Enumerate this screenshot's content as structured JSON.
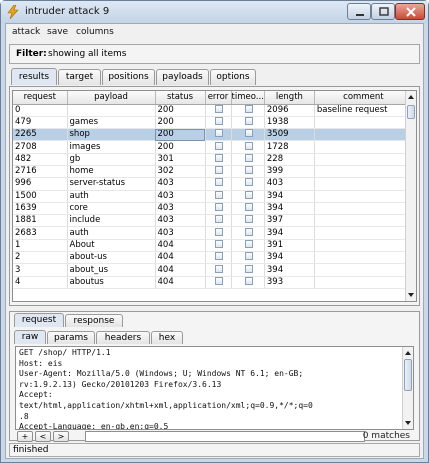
{
  "window": {
    "title": "intruder attack 9"
  },
  "menu": [
    "attack",
    "save",
    "columns"
  ],
  "filter": {
    "label": "Filter:",
    "text": "showing all items"
  },
  "tabs": [
    "results",
    "target",
    "positions",
    "payloads",
    "options"
  ],
  "table": {
    "columns": [
      "request",
      "payload",
      "status",
      "error",
      "timeo...",
      "length",
      "comment"
    ],
    "rows": [
      {
        "request": "0",
        "payload": "",
        "status": "200",
        "length": "2096",
        "comment": "baseline request"
      },
      {
        "request": "479",
        "payload": "games",
        "status": "200",
        "length": "1938",
        "comment": ""
      },
      {
        "request": "2265",
        "payload": "shop",
        "status": "200",
        "length": "3509",
        "comment": ""
      },
      {
        "request": "2708",
        "payload": "images",
        "status": "200",
        "length": "1728",
        "comment": ""
      },
      {
        "request": "482",
        "payload": "gb",
        "status": "301",
        "length": "228",
        "comment": ""
      },
      {
        "request": "2716",
        "payload": "home",
        "status": "302",
        "length": "399",
        "comment": ""
      },
      {
        "request": "996",
        "payload": "server-status",
        "status": "403",
        "length": "403",
        "comment": ""
      },
      {
        "request": "1500",
        "payload": "auth",
        "status": "403",
        "length": "394",
        "comment": ""
      },
      {
        "request": "1639",
        "payload": "core",
        "status": "403",
        "length": "394",
        "comment": ""
      },
      {
        "request": "1881",
        "payload": "include",
        "status": "403",
        "length": "397",
        "comment": ""
      },
      {
        "request": "2683",
        "payload": "auth",
        "status": "403",
        "length": "394",
        "comment": ""
      },
      {
        "request": "1",
        "payload": "About",
        "status": "404",
        "length": "391",
        "comment": ""
      },
      {
        "request": "2",
        "payload": "about-us",
        "status": "404",
        "length": "394",
        "comment": ""
      },
      {
        "request": "3",
        "payload": "about_us",
        "status": "404",
        "length": "394",
        "comment": ""
      },
      {
        "request": "4",
        "payload": "aboutus",
        "status": "404",
        "length": "393",
        "comment": ""
      }
    ],
    "selected_row": 2
  },
  "request_tabs": [
    "request",
    "response"
  ],
  "view_tabs": [
    "raw",
    "params",
    "headers",
    "hex"
  ],
  "request_text": "GET /shop/ HTTP/1.1\nHost: eis\nUser-Agent: Mozilla/5.0 (Windows; U; Windows NT 6.1; en-GB;\nrv:1.9.2.13) Gecko/20101203 Firefox/3.6.13\nAccept:\ntext/html,application/xhtml+xml,application/xml;q=0.9,*/*;q=0\n.8\nAccept-Language: en-gb,en;q=0.5",
  "search": {
    "buttons": [
      "+",
      "<",
      ">"
    ],
    "value": "",
    "matches": "0 matches"
  },
  "status": "finished",
  "colors": {
    "selection": "#b8cfe5",
    "title_gradient_top": "#dde8f4",
    "close_button": "#c74b37",
    "app_icon": "#e8a21a"
  }
}
